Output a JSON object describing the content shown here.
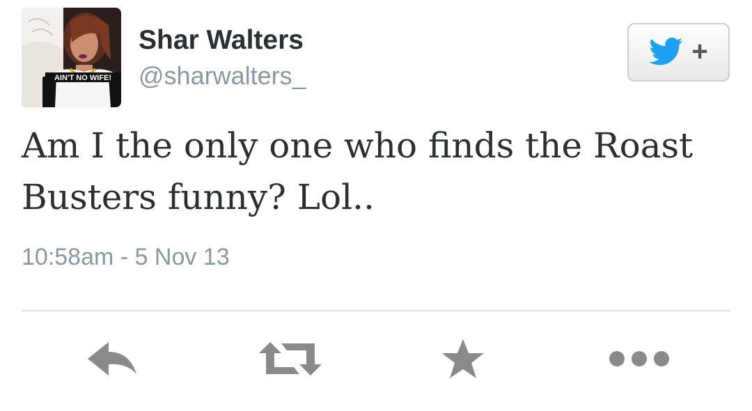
{
  "user": {
    "display_name": "Shar Walters",
    "handle": "@sharwalters_",
    "shirt_text": "AIN'T NO WIFE!"
  },
  "follow_button": {
    "icon": "twitter-bird-icon",
    "plus": "+"
  },
  "tweet": {
    "text": "Am I the only one who finds the Roast Busters funny? Lol..",
    "timestamp": "10:58am - 5 Nov 13"
  },
  "actions": [
    {
      "name": "reply",
      "icon": "reply-icon"
    },
    {
      "name": "retweet",
      "icon": "retweet-icon"
    },
    {
      "name": "favorite",
      "icon": "star-icon"
    },
    {
      "name": "more",
      "icon": "more-icon"
    }
  ],
  "colors": {
    "twitter_blue": "#1da1f2",
    "action_gray": "#8a8a8a",
    "text_dark": "#292f33",
    "text_muted": "#8899a6"
  }
}
